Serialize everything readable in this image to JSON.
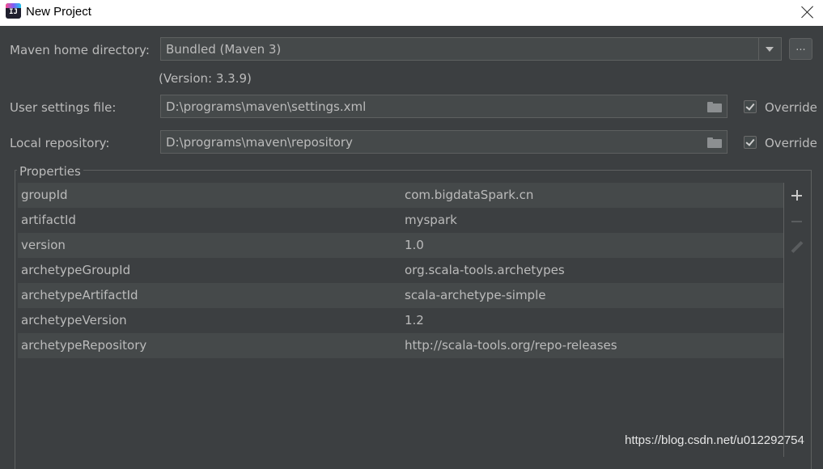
{
  "window": {
    "title": "New Project",
    "icon_text": "IJ"
  },
  "maven": {
    "home_label": "Maven home directory:",
    "home_value": "Bundled (Maven 3)",
    "browse_label": "...",
    "version_text": "(Version: 3.3.9)",
    "settings_label": "User settings file:",
    "settings_value": "D:\\programs\\maven\\settings.xml",
    "settings_override": "Override",
    "settings_override_checked": true,
    "repo_label": "Local repository:",
    "repo_value": "D:\\programs\\maven\\repository",
    "repo_override": "Override",
    "repo_override_checked": true
  },
  "properties": {
    "title": "Properties",
    "rows": [
      {
        "key": "groupId",
        "value": "com.bigdataSpark.cn"
      },
      {
        "key": "artifactId",
        "value": "myspark"
      },
      {
        "key": "version",
        "value": "1.0"
      },
      {
        "key": "archetypeGroupId",
        "value": "org.scala-tools.archetypes"
      },
      {
        "key": "archetypeArtifactId",
        "value": "scala-archetype-simple"
      },
      {
        "key": "archetypeVersion",
        "value": "1.2"
      },
      {
        "key": "archetypeRepository",
        "value": "http://scala-tools.org/repo-releases"
      }
    ]
  },
  "icons": {
    "add": "plus-icon",
    "remove": "minus-icon",
    "edit": "pencil-icon",
    "browse": "folder-icon",
    "close": "close-icon"
  },
  "watermark": "https://blog.csdn.net/u012292754"
}
